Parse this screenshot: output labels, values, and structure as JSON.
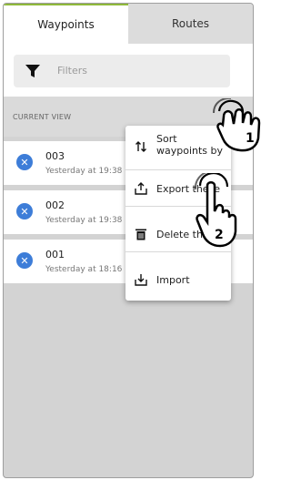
{
  "tabs": [
    {
      "label": "Waypoints",
      "active": true
    },
    {
      "label": "Routes",
      "active": false
    }
  ],
  "filter": {
    "icon": "funnel-icon",
    "placeholder": "Filters"
  },
  "section": {
    "label": "CURRENT VIEW"
  },
  "waypoints": [
    {
      "name": "003",
      "time": "Yesterday at 19:38",
      "icon": "close-circle-icon"
    },
    {
      "name": "002",
      "time": "Yesterday at 19:38",
      "icon": "close-circle-icon"
    },
    {
      "name": "001",
      "time": "Yesterday at 18:16",
      "icon": "close-circle-icon"
    }
  ],
  "context_menu": {
    "items": [
      {
        "label_line1": "Sort",
        "label_line2": "waypoints by",
        "icon": "sort-icon"
      },
      {
        "label": "Export these",
        "icon": "export-icon"
      },
      {
        "label": "Delete these",
        "icon": "trash-icon"
      },
      {
        "label": "Import",
        "icon": "import-icon"
      }
    ]
  },
  "callouts": [
    {
      "number": "1"
    },
    {
      "number": "2"
    }
  ],
  "colors": {
    "accent": "#8fb93a",
    "icon_blue": "#3d7dd8"
  }
}
